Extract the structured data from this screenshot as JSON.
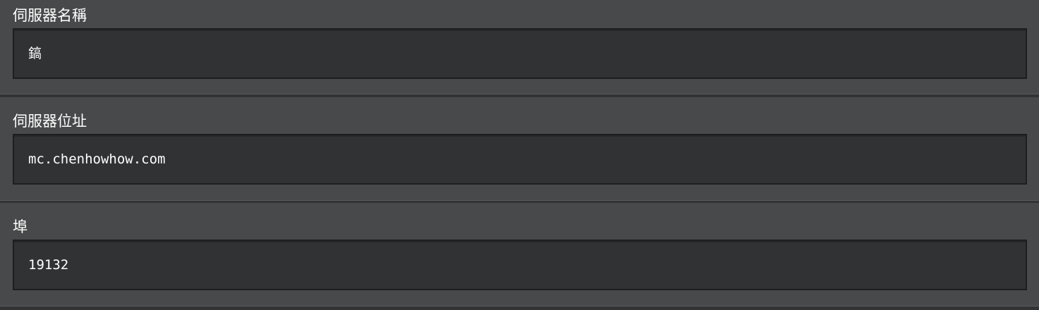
{
  "form": {
    "fields": [
      {
        "label": "伺服器名稱",
        "value": "鎬"
      },
      {
        "label": "伺服器位址",
        "value": "mc.chenhowhow.com"
      },
      {
        "label": "埠",
        "value": "19132"
      }
    ]
  }
}
